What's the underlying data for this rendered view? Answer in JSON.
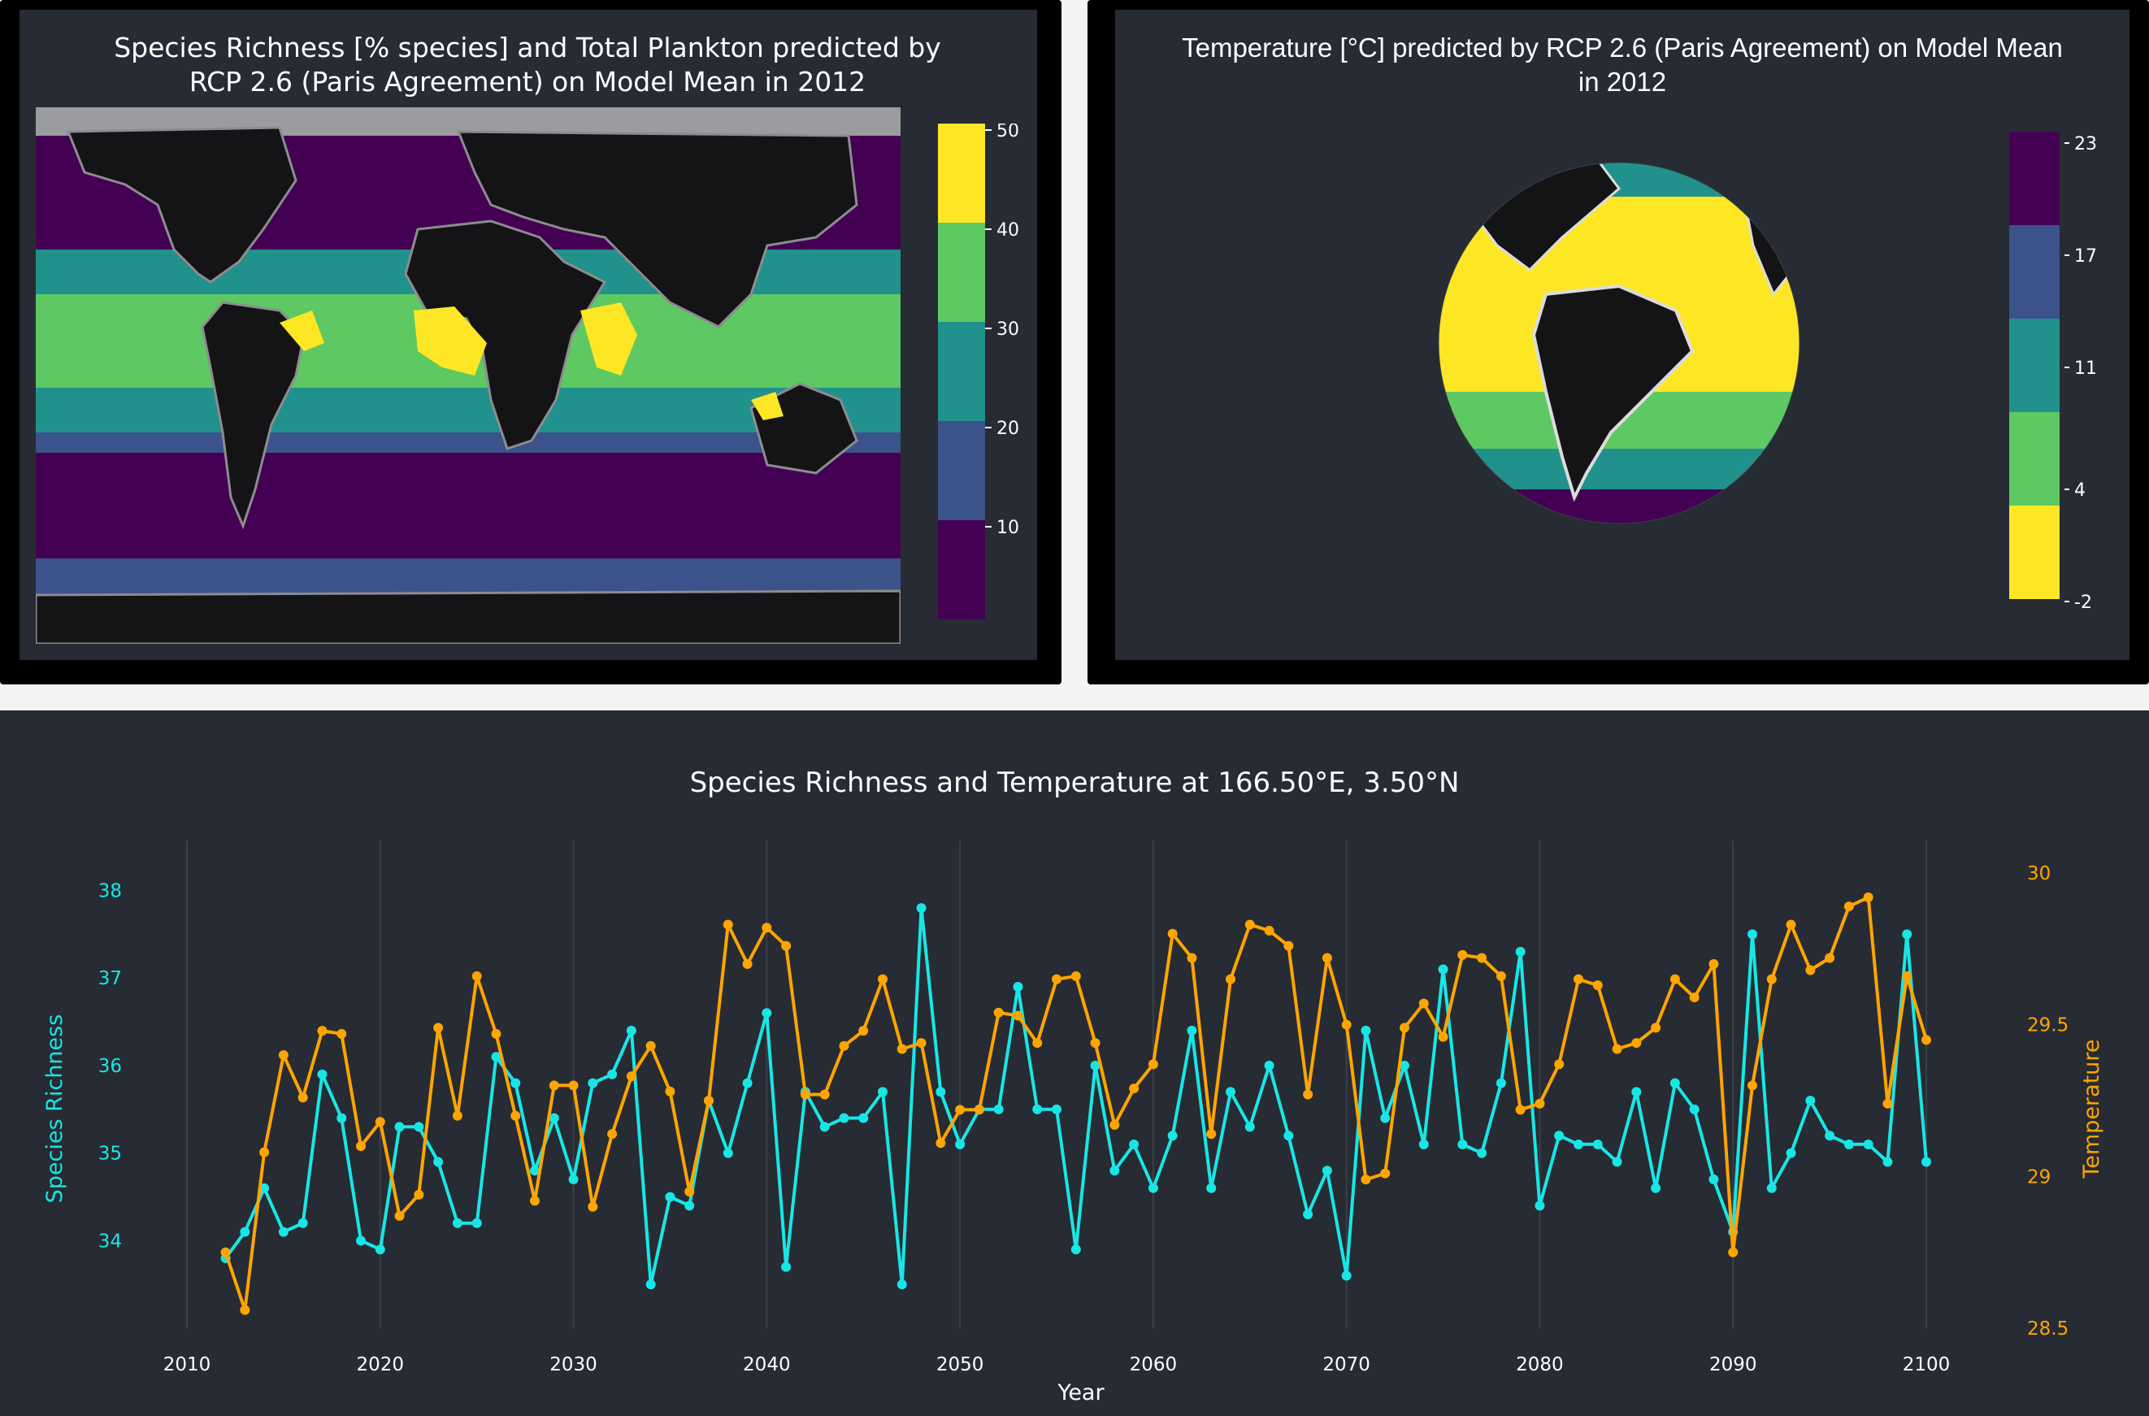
{
  "colors": {
    "panel_bg": "#272b33",
    "frame": "#000000",
    "richness_line": "#18e6e6",
    "temperature_line": "#ffa500",
    "viridis": [
      "#440154",
      "#3b528b",
      "#21918c",
      "#5ec962",
      "#fde725"
    ],
    "land": "#141416",
    "gridline": "#3a3f49"
  },
  "map_panel": {
    "title_line1": "Species Richness [% species] and Total Plankton predicted by",
    "title_line2": "RCP 2.6 (Paris Agreement) on Model Mean in 2012",
    "colorbar_ticks": [
      "50",
      "40",
      "30",
      "20",
      "10"
    ],
    "colorbar_range": [
      0,
      50
    ]
  },
  "globe_panel": {
    "title_line1": "Temperature [°C] predicted by RCP 2.6 (Paris Agreement) on Model Mean",
    "title_line2": "in 2012",
    "colorbar_ticks": [
      "23",
      "17",
      "11",
      "4",
      "-2"
    ],
    "colorbar_range": [
      -2,
      23
    ]
  },
  "timeseries_panel": {
    "title": "Species Richness and Temperature at 166.50°E, 3.50°N"
  },
  "chart_data": [
    {
      "type": "heatmap",
      "title": "Species Richness [% species] and Total Plankton predicted by RCP 2.6 (Paris Agreement) on Model Mean in 2012",
      "projection": "equirectangular world map",
      "colorscale": "viridis (discrete, 5 bins)",
      "colorbar": {
        "range": [
          0,
          50
        ],
        "ticks": [
          10,
          20,
          30,
          40,
          50
        ]
      }
    },
    {
      "type": "scatter",
      "title": "Temperature [°C] predicted by RCP 2.6 (Paris Agreement) on Model Mean in 2012",
      "projection": "orthographic globe centered on the Americas / Atlantic",
      "colorscale": "viridis reversed (discrete, 5 bins)",
      "colorbar": {
        "range": [
          -2,
          23
        ],
        "ticks": [
          -2,
          4,
          11,
          17,
          23
        ]
      }
    },
    {
      "type": "line",
      "title": "Species Richness and Temperature at 166.50°E, 3.50°N",
      "xlabel": "Year",
      "x_ticks": [
        2010,
        2020,
        2030,
        2040,
        2050,
        2060,
        2070,
        2080,
        2090,
        2100
      ],
      "xlim": [
        2010,
        2100
      ],
      "ylabel_left": "Species Richness",
      "y_left_ticks": [
        34,
        35,
        36,
        37,
        38
      ],
      "ylim_left": [
        33,
        38.2
      ],
      "ylabel_right": "Temperature",
      "y_right_ticks": [
        "28.5",
        "29",
        "29.5",
        "30"
      ],
      "ylim_right": [
        28.5,
        30.0
      ],
      "x_grid": true,
      "x": [
        2012,
        2013,
        2014,
        2015,
        2016,
        2017,
        2018,
        2019,
        2020,
        2021,
        2022,
        2023,
        2024,
        2025,
        2026,
        2027,
        2028,
        2029,
        2030,
        2031,
        2032,
        2033,
        2034,
        2035,
        2036,
        2037,
        2038,
        2039,
        2040,
        2041,
        2042,
        2043,
        2044,
        2045,
        2046,
        2047,
        2048,
        2049,
        2050,
        2051,
        2052,
        2053,
        2054,
        2055,
        2056,
        2057,
        2058,
        2059,
        2060,
        2061,
        2062,
        2063,
        2064,
        2065,
        2066,
        2067,
        2068,
        2069,
        2070,
        2071,
        2072,
        2073,
        2074,
        2075,
        2076,
        2077,
        2078,
        2079,
        2080,
        2081,
        2082,
        2083,
        2084,
        2085,
        2086,
        2087,
        2088,
        2089,
        2090,
        2091,
        2092,
        2093,
        2094,
        2095,
        2096,
        2097,
        2098,
        2099,
        2100
      ],
      "series": [
        {
          "name": "Species Richness",
          "axis": "left",
          "values": [
            33.8,
            34.1,
            34.6,
            34.1,
            34.2,
            35.9,
            35.4,
            34.0,
            33.9,
            35.3,
            35.3,
            34.9,
            34.2,
            34.2,
            36.1,
            35.8,
            34.8,
            35.4,
            34.7,
            35.8,
            35.9,
            36.4,
            33.5,
            34.5,
            34.4,
            35.6,
            35.0,
            35.8,
            36.6,
            33.7,
            35.7,
            35.3,
            35.4,
            35.4,
            35.7,
            33.5,
            37.8,
            35.7,
            35.1,
            35.5,
            35.5,
            36.9,
            35.5,
            35.5,
            33.9,
            36.0,
            34.8,
            35.1,
            34.6,
            35.2,
            36.4,
            34.6,
            35.7,
            35.3,
            36.0,
            35.2,
            34.3,
            34.8,
            33.6,
            36.4,
            35.4,
            36.0,
            35.1,
            37.1,
            35.1,
            35.0,
            35.8,
            37.3,
            34.4,
            35.2,
            35.1,
            35.1,
            34.9,
            35.7,
            34.6,
            35.8,
            35.5,
            34.7,
            34.1,
            37.5,
            34.6,
            35.0,
            35.6,
            35.2,
            35.1,
            35.1,
            34.9,
            37.5,
            34.9
          ]
        },
        {
          "name": "Temperature",
          "axis": "right",
          "values": [
            28.75,
            28.56,
            29.08,
            29.4,
            29.26,
            29.48,
            29.47,
            29.1,
            29.18,
            28.87,
            28.94,
            29.49,
            29.2,
            29.66,
            29.47,
            29.2,
            28.92,
            29.3,
            29.3,
            28.9,
            29.14,
            29.33,
            29.43,
            29.28,
            28.95,
            29.25,
            29.83,
            29.7,
            29.82,
            29.76,
            29.27,
            29.27,
            29.43,
            29.48,
            29.65,
            29.42,
            29.44,
            29.11,
            29.22,
            29.22,
            29.54,
            29.53,
            29.44,
            29.65,
            29.66,
            29.44,
            29.17,
            29.29,
            29.37,
            29.8,
            29.72,
            29.14,
            29.65,
            29.83,
            29.81,
            29.76,
            29.27,
            29.72,
            29.5,
            28.99,
            29.01,
            29.49,
            29.57,
            29.46,
            29.73,
            29.72,
            29.66,
            29.22,
            29.24,
            29.37,
            29.65,
            29.63,
            29.42,
            29.44,
            29.49,
            29.65,
            29.59,
            29.7,
            28.75,
            29.3,
            29.65,
            29.83,
            29.68,
            29.72,
            29.89,
            29.92,
            29.24,
            29.66,
            29.45
          ]
        }
      ]
    }
  ]
}
